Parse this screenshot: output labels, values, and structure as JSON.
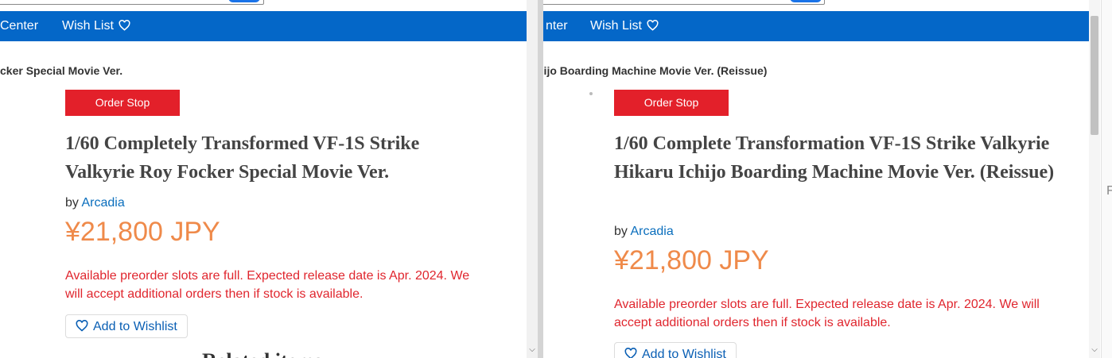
{
  "left": {
    "nav": {
      "item1": "Center",
      "item2": "Wish List"
    },
    "breadcrumb": "cker Special Movie Ver.",
    "status_badge": "Order Stop",
    "title": "1/60 Completely Transformed VF-1S Strike Valkyrie Roy Focker Special Movie Ver.",
    "by_prefix": "by",
    "maker": "Arcadia",
    "price": "¥21,800 JPY",
    "notice": "Available preorder slots are full. Expected release date is Apr. 2024. We will accept additional orders then if stock is available.",
    "wishlist_button": "Add to Wishlist",
    "partial_heading": "Related items"
  },
  "right": {
    "nav": {
      "item1": "nter",
      "item2": "Wish List"
    },
    "breadcrumb": "hijo Boarding Machine Movie Ver. (Reissue)",
    "status_badge": "Order Stop",
    "title": "1/60 Complete Transformation VF-1S Strike Valkyrie Hikaru Ichijo Boarding Machine Movie Ver. (Reissue)",
    "by_prefix": "by",
    "maker": "Arcadia",
    "price": "¥21,800 JPY",
    "notice": "Available preorder slots are full. Expected release date is Apr. 2024. We will accept additional orders then if stock is available.",
    "wishlist_button": "Add to Wishlist"
  },
  "edge": {
    "text": "F"
  },
  "colors": {
    "nav": "#0467c8",
    "badge": "#e3202a",
    "price": "#ef8a4a",
    "notice": "#e0262e",
    "link": "#0a6ebd"
  },
  "icons": {
    "wishlist": "heart-outline-icon",
    "scroll_down": "chevron-down-icon"
  }
}
